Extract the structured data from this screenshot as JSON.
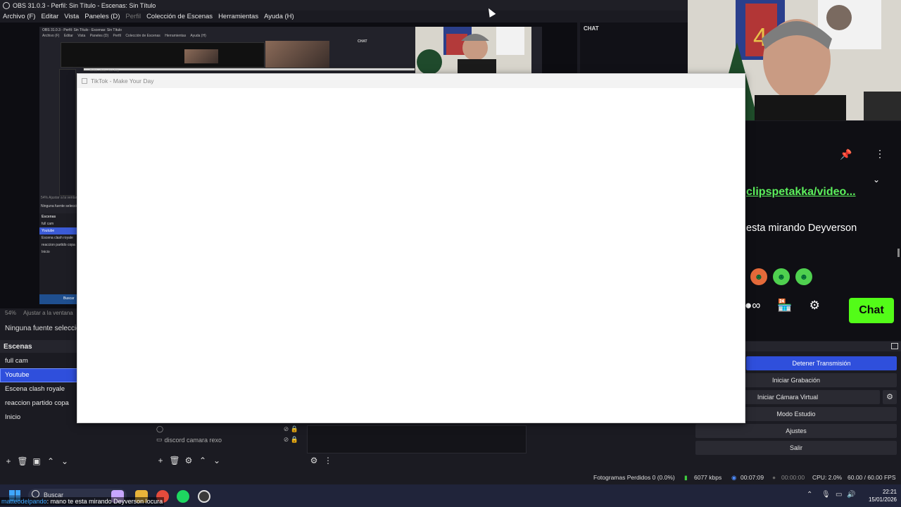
{
  "window": {
    "title": "OBS 31.0.3 - Perfil: Sin Título - Escenas: Sin Título"
  },
  "menu": [
    {
      "label": "Archivo (F)",
      "enabled": true
    },
    {
      "label": "Editar",
      "enabled": true
    },
    {
      "label": "Vista",
      "enabled": true
    },
    {
      "label": "Paneles (D)",
      "enabled": true
    },
    {
      "label": "Perfil",
      "enabled": false
    },
    {
      "label": "Colección de Escenas",
      "enabled": true
    },
    {
      "label": "Herramientas",
      "enabled": true
    },
    {
      "label": "Ayuda (H)",
      "enabled": true
    }
  ],
  "nested_preview": {
    "title": "OBS 31.0.3 - Perfil: Sin Título - Escenas: Sin Título",
    "menu": [
      "Archivo (F)",
      "Editar",
      "Vista",
      "Paneles (D)",
      "Perfil",
      "Colección de Escenas",
      "Herramientas",
      "Ayuda (H)"
    ],
    "chat_label": "CHAT",
    "window_label": "TikTok - Make Your Day",
    "zoom_text": "54%   Ajustar a la ventana",
    "no_source": "Ninguna fuente seleccionada",
    "scenes_head": "Escenas",
    "scenes": [
      "full cam",
      "Youtube",
      "Escena clash royale",
      "reaccion partido copa",
      "Inicio"
    ],
    "search": "Buscar"
  },
  "preview": {
    "zoom": "54%",
    "fit_label": "Ajustar a la ventana"
  },
  "no_source": "Ninguna fuente seleccionada",
  "scenes": {
    "heading": "Escenas",
    "items": [
      "full cam",
      "Youtube",
      "Escena clash royale",
      "reaccion partido copa",
      "Inicio"
    ],
    "active_index": 1
  },
  "sources": {
    "items": [
      {
        "label": "discord camara rexo"
      }
    ]
  },
  "controls": {
    "stop_stream": "Detener Transmisión",
    "start_recording": "Iniciar Grabación",
    "start_virtual_cam": "Iniciar Cámara Virtual",
    "studio_mode": "Modo Estudio",
    "settings": "Ajustes",
    "exit": "Salir"
  },
  "chat_overlay": {
    "header_label": "CHAT",
    "link_text": "clipspetakka/video...",
    "message": "esta mirando Deyverson",
    "chat_button": "Chat"
  },
  "tiktok_window": {
    "title": "TikTok - Make Your Day"
  },
  "status": {
    "dropped_frames": "Fotogramas Perdidos 0 (0.0%)",
    "bitrate": "6077 kbps",
    "stream_time": "00:07:09",
    "rec_time": "00:00:00",
    "cpu": "CPU: 2.0%",
    "fps": "60.00 / 60.00 FPS"
  },
  "taskbar": {
    "search_placeholder": "Buscar",
    "ticker_user": "matteodelpando",
    "ticker_text": ": mano te esta mirando Deyverson locura",
    "time": "22:21",
    "date": "15/01/2026"
  },
  "colors": {
    "accent_blue": "#2f4fdc",
    "kick_green": "#53fc18",
    "link_green": "#5cf05c",
    "panel_bg": "#1b1b22"
  }
}
